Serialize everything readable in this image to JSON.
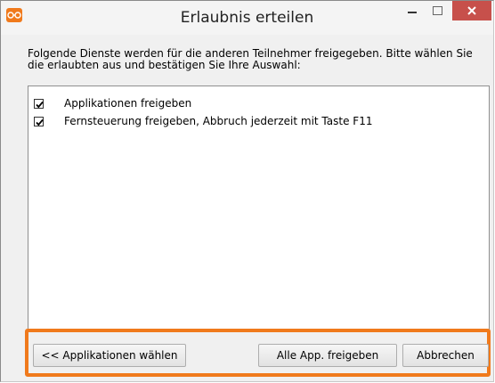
{
  "window": {
    "title": "Erlaubnis erteilen",
    "accent_color": "#f07a1c",
    "close_color": "#c7504b"
  },
  "instruction": "Folgende Dienste werden für die anderen Teilnehmer freigegeben. Bitte wählen Sie die erlaubten aus und bestätigen Sie Ihre Auswahl:",
  "services": [
    {
      "label": "Applikationen freigeben",
      "checked": true
    },
    {
      "label": "Fernsteuerung freigeben, Abbruch jederzeit mit Taste F11",
      "checked": true
    }
  ],
  "buttons": {
    "choose_apps": "<< Applikationen wählen",
    "share_all": "Alle App. freigeben",
    "cancel": "Abbrechen"
  }
}
